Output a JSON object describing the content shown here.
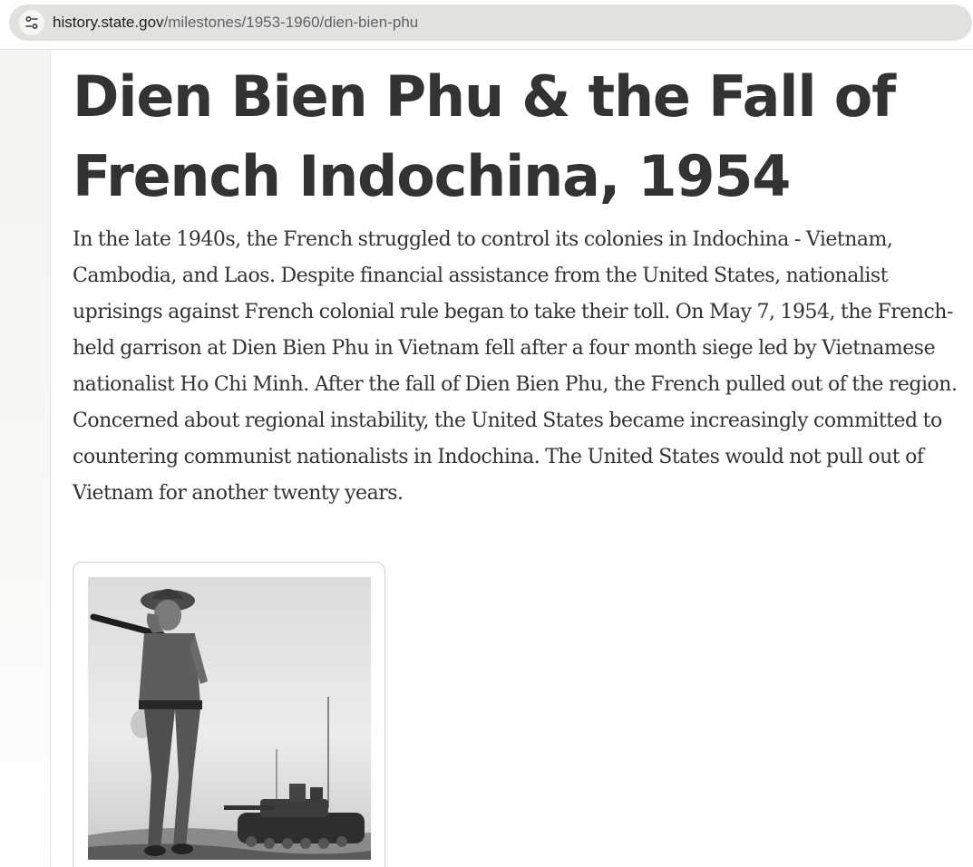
{
  "browser": {
    "url_host": "history.state.gov",
    "url_path": "/milestones/1953-1960/dien-bien-phu"
  },
  "article": {
    "title": "Dien Bien Phu & the Fall of French Indochina, 1954",
    "intro": "In the late 1940s, the French struggled to control its colonies in Indochina - Vietnam, Cambodia, and Laos. Despite financial assistance from the United States, nationalist uprisings against French colonial rule began to take their toll. On May 7, 1954, the French-held garrison at Dien Bien Phu in Vietnam fell after a four month siege led by Vietnamese nationalist Ho Chi Minh. After the fall of Dien Bien Phu, the French pulled out of the region. Concerned about regional instability, the United States became increasingly committed to countering communist nationalists in Indochina. The United States would not pull out of Vietnam for another twenty years."
  },
  "figure": {
    "icon": "photo-soldier-with-tank"
  },
  "colors": {
    "text": "#333333",
    "omnibox_bg": "#e1e1de",
    "url_path": "#5f6368"
  }
}
